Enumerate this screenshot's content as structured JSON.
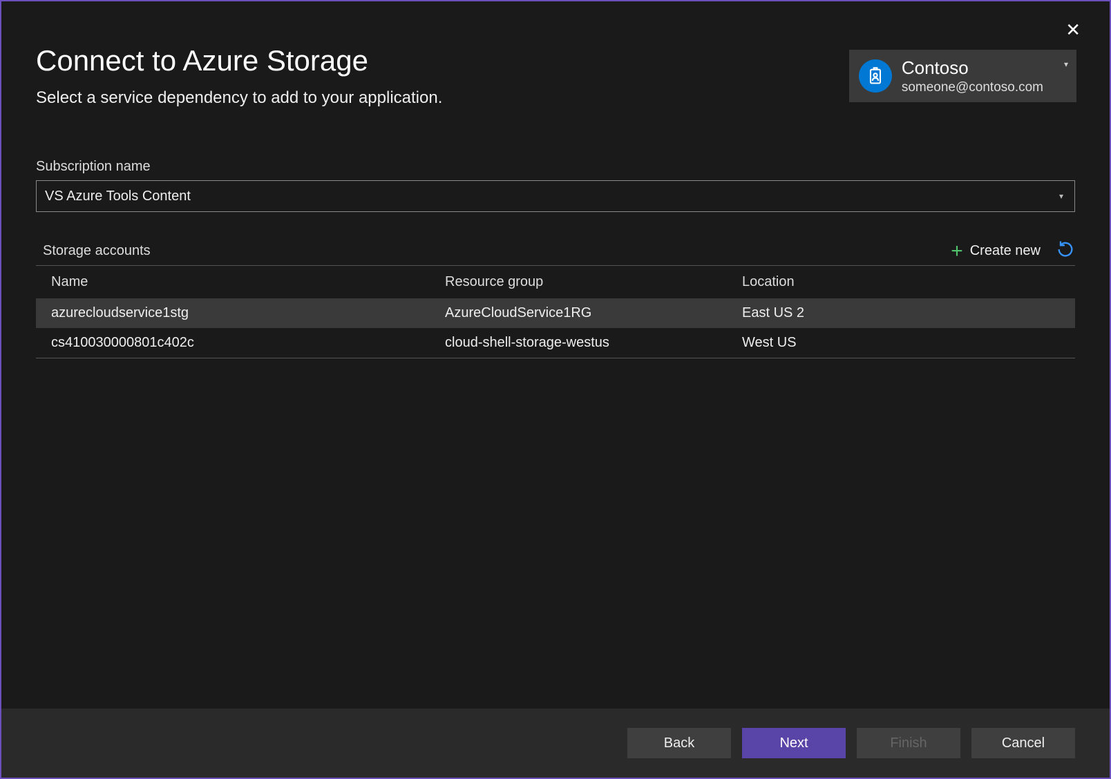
{
  "header": {
    "title": "Connect to Azure Storage",
    "subtitle": "Select a service dependency to add to your application."
  },
  "account": {
    "org": "Contoso",
    "email": "someone@contoso.com"
  },
  "subscription": {
    "label": "Subscription name",
    "selected": "VS Azure Tools Content"
  },
  "storage": {
    "section_label": "Storage accounts",
    "create_new_label": "Create new",
    "columns": {
      "name": "Name",
      "resource_group": "Resource group",
      "location": "Location"
    },
    "rows": [
      {
        "name": "azurecloudservice1stg",
        "resource_group": "AzureCloudService1RG",
        "location": "East US 2",
        "selected": true
      },
      {
        "name": "cs410030000801c402c",
        "resource_group": "cloud-shell-storage-westus",
        "location": "West US",
        "selected": false
      }
    ]
  },
  "footer": {
    "back": "Back",
    "next": "Next",
    "finish": "Finish",
    "cancel": "Cancel"
  },
  "colors": {
    "accent": "#5944a8",
    "border": "#6b4fbb",
    "link": "#3794ff",
    "success": "#4fc26b",
    "brand_blue": "#0078d4"
  }
}
